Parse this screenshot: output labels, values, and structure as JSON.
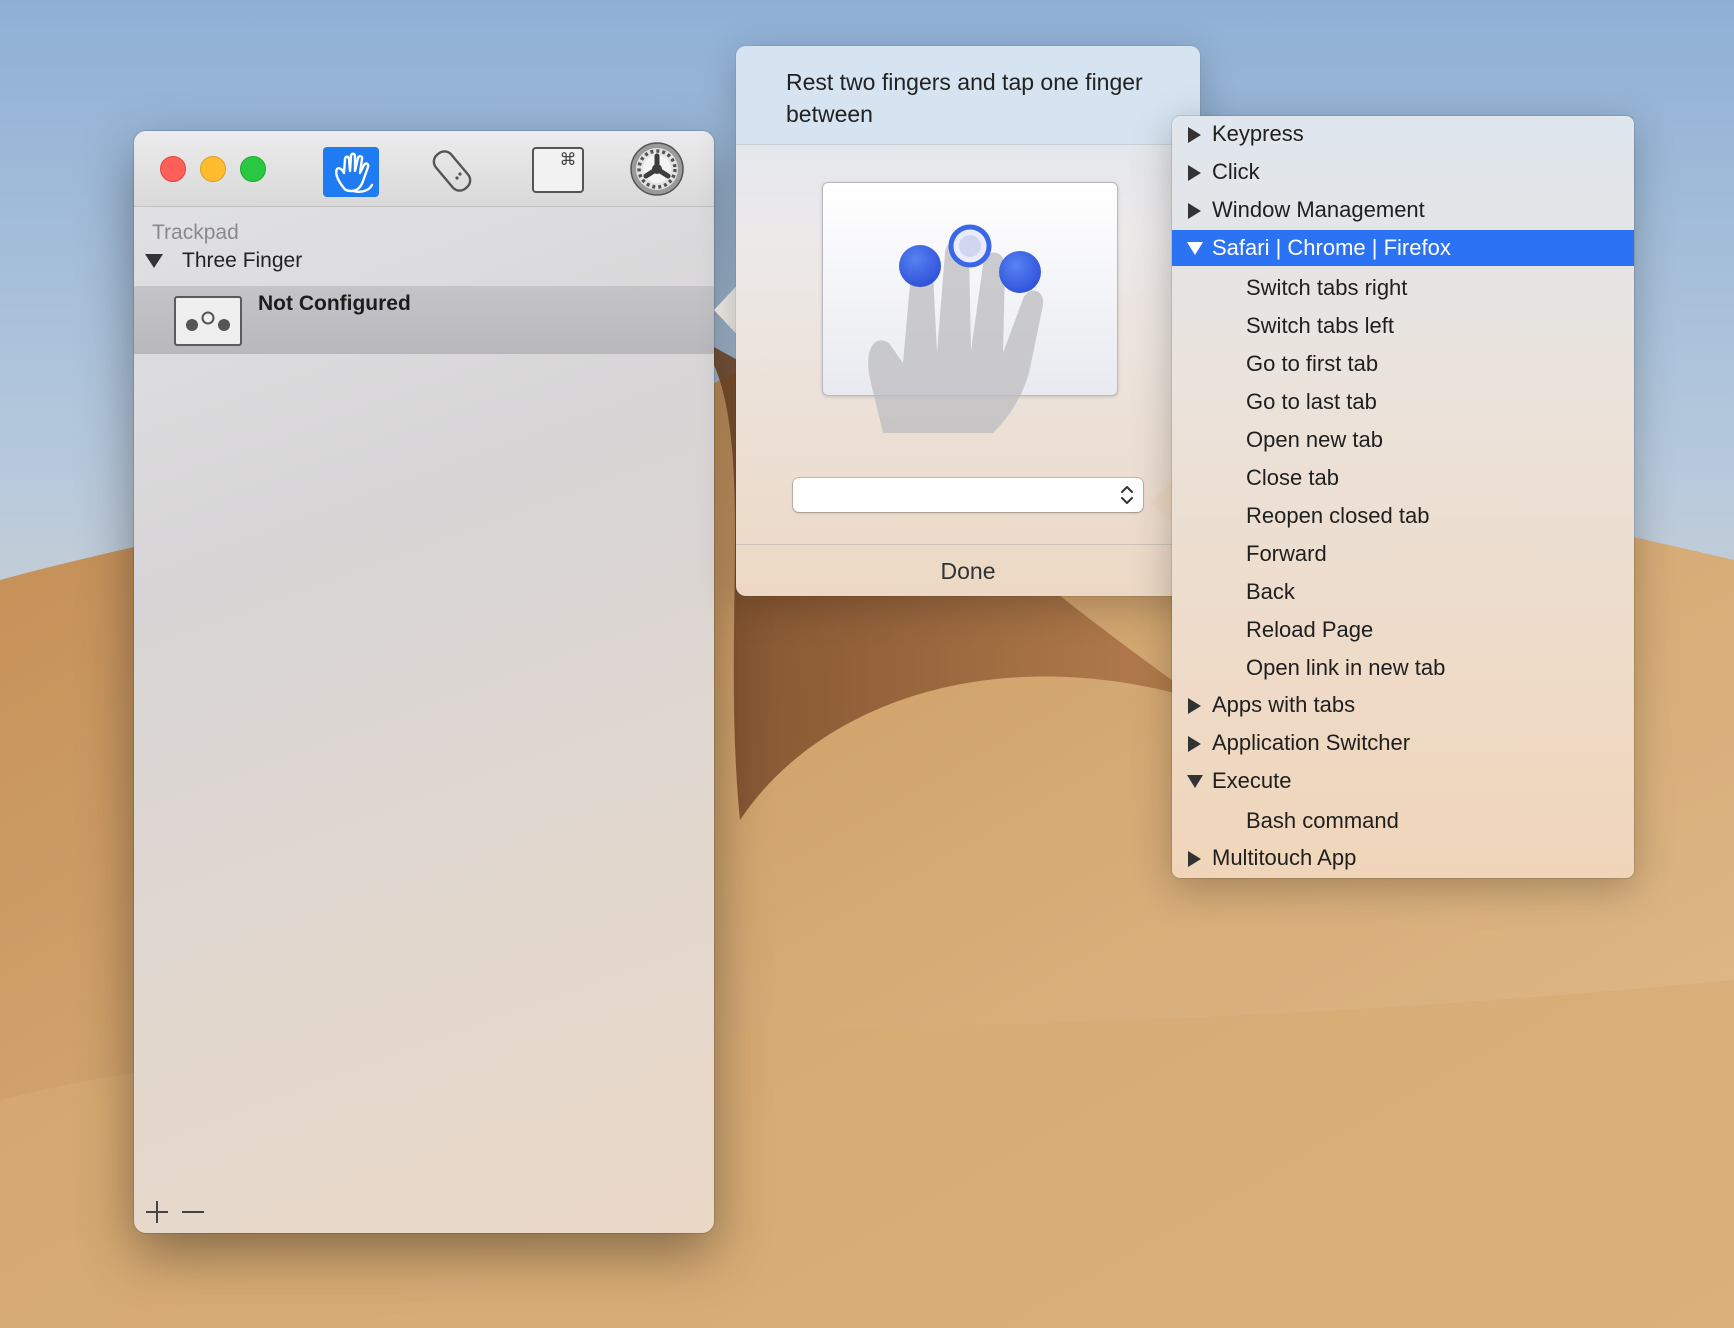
{
  "main_window": {
    "toolbar": {
      "items": [
        "gestures-icon",
        "remote-icon",
        "keyboard-shortcut-icon",
        "preferences-gear-icon"
      ],
      "selected": "gestures-icon"
    },
    "sidebar": {
      "heading": "Trackpad",
      "group": {
        "label": "Three Finger",
        "expanded": true
      },
      "gesture": {
        "title": "Not Configured",
        "icon": "three-finger-tap-icon"
      }
    },
    "footer": {
      "add": "+",
      "remove": "−"
    }
  },
  "popover": {
    "title": "Rest two fingers and tap one finger between",
    "select": {
      "value": ""
    },
    "done_label": "Done"
  },
  "menu": {
    "items": [
      {
        "label": "Keypress",
        "kind": "group",
        "expanded": false
      },
      {
        "label": "Click",
        "kind": "group",
        "expanded": false
      },
      {
        "label": "Window Management",
        "kind": "group",
        "expanded": false
      },
      {
        "label": "Safari | Chrome | Firefox",
        "kind": "group",
        "expanded": true,
        "selected": true
      },
      {
        "label": "Switch tabs right",
        "kind": "leaf"
      },
      {
        "label": "Switch tabs left",
        "kind": "leaf"
      },
      {
        "label": "Go to first tab",
        "kind": "leaf"
      },
      {
        "label": "Go to last tab",
        "kind": "leaf"
      },
      {
        "label": "Open new tab",
        "kind": "leaf"
      },
      {
        "label": "Close tab",
        "kind": "leaf"
      },
      {
        "label": "Reopen closed tab",
        "kind": "leaf"
      },
      {
        "label": "Forward",
        "kind": "leaf"
      },
      {
        "label": "Back",
        "kind": "leaf"
      },
      {
        "label": "Reload Page",
        "kind": "leaf"
      },
      {
        "label": "Open link in new tab",
        "kind": "leaf"
      },
      {
        "label": "Apps with tabs",
        "kind": "group",
        "expanded": false
      },
      {
        "label": "Application Switcher",
        "kind": "group",
        "expanded": false
      },
      {
        "label": "Execute",
        "kind": "group",
        "expanded": true
      },
      {
        "label": "Bash command",
        "kind": "leaf"
      },
      {
        "label": "Multitouch App",
        "kind": "group",
        "expanded": false
      }
    ]
  },
  "colors": {
    "selection": "#2b73f2",
    "finger_dot": "#2d5be3",
    "close": "#fe5f57",
    "minimize": "#febc2e",
    "zoom": "#28c840"
  }
}
